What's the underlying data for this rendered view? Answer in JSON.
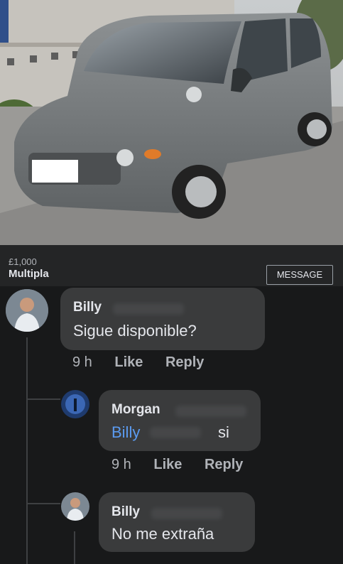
{
  "listing": {
    "price": "£1,000",
    "title": "Multipla",
    "message_button": "MESSAGE"
  },
  "comments": [
    {
      "name": "Billy",
      "text": "Sigue disponible?",
      "time": "9 h",
      "like": "Like",
      "reply": "Reply"
    },
    {
      "name": "Morgan",
      "mention": "Billy",
      "text": "si",
      "time": "9 h",
      "like": "Like",
      "reply": "Reply"
    },
    {
      "name": "Billy",
      "text": "No me extraña"
    }
  ]
}
